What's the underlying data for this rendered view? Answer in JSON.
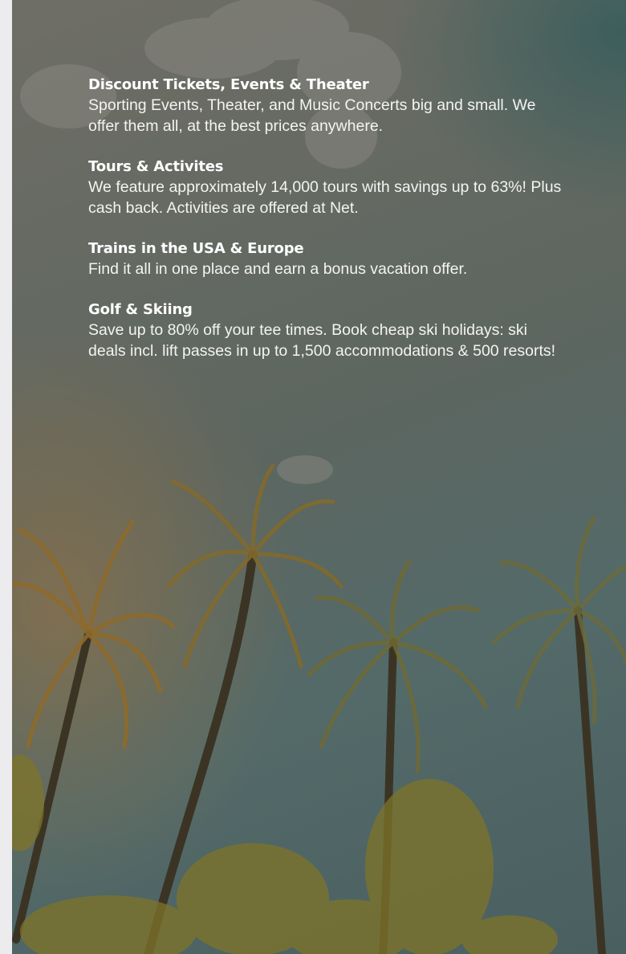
{
  "sections": [
    {
      "title": "Discount Tickets, Events & Theater",
      "body": "Sporting Events, Theater, and Music Concerts big and small. We offer them all, at the best prices anywhere."
    },
    {
      "title": "Tours & Activites",
      "body": "We feature approximately 14,000 tours with savings up to 63%! Plus cash back. Activities are offered at Net."
    },
    {
      "title": "Trains in the USA & Europe",
      "body": "Find it all in one place and earn a bonus vacation offer."
    },
    {
      "title": "Golf & Skiing",
      "body": "Save up to 80% off your tee times. Book cheap ski holidays: ski deals incl. lift passes in up to 1,500 accommodations & 500 resorts!"
    }
  ],
  "background": {
    "image": "palm-trees-sky-photo",
    "colors": {
      "sky": "#5d6660",
      "teal": "#4a5f60",
      "warm": "#ad783a",
      "foliage": "#8a7a2a",
      "trunk": "#3a3322"
    }
  }
}
